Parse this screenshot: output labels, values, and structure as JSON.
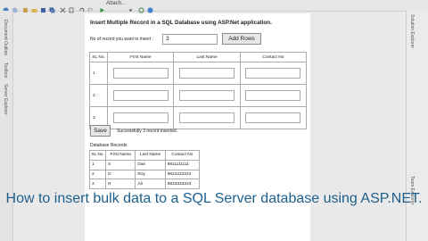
{
  "toolbar": {
    "attach_label": "Attach..."
  },
  "left_rail": {
    "tabs": [
      "Document Outline",
      "Toolbox",
      "Server Explorer"
    ]
  },
  "right_rail": {
    "tabs": [
      "Solution Explorer",
      "Team Explorer"
    ]
  },
  "page": {
    "title": "Insert Multiple Record in a SQL Database using ASP.Net application.",
    "record_count_label": "No of record you want to insert :",
    "record_count_value": "3",
    "add_rows_label": "Add Rows",
    "input_headers": [
      "SL No.",
      "First Name",
      "Last Name",
      "Contact No"
    ],
    "input_rows": [
      "1",
      "2",
      "3"
    ],
    "save_label": "Save",
    "status_message": "Successfully 3 record inserted.",
    "db_records_label": "Database Records",
    "db_headers": [
      "SL No.",
      "First Name",
      "Last Name",
      "Contact No"
    ],
    "db_rows": [
      [
        "1",
        "S",
        "Das",
        "9811111111"
      ],
      [
        "2",
        "D",
        "Roy",
        "9822222222"
      ],
      [
        "3",
        "R",
        "Ali",
        "9833333333"
      ]
    ]
  },
  "caption": "How to insert bulk data to a SQL Server database using ASP.NET."
}
